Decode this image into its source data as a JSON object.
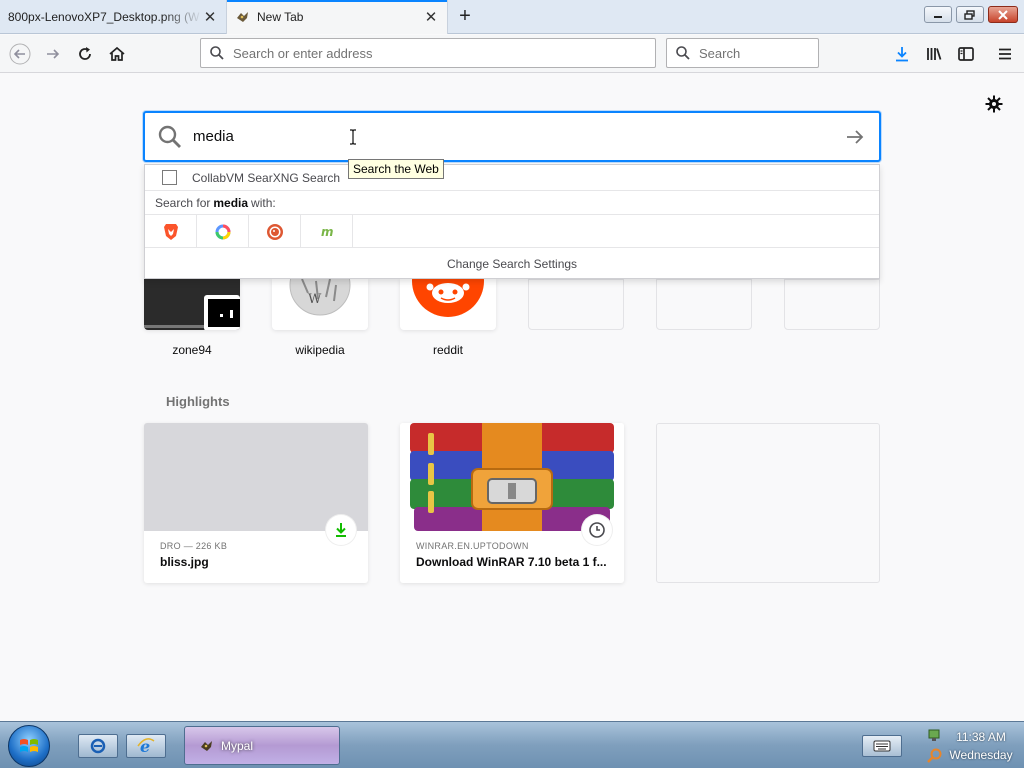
{
  "tabs": [
    {
      "title": "800px-LenovoXP7_Desktop.png (W",
      "close_icon": "close-icon"
    },
    {
      "title": "New Tab",
      "close_icon": "close-icon"
    }
  ],
  "toolbar": {
    "address_placeholder": "Search or enter address",
    "search_placeholder": "Search"
  },
  "newtab": {
    "search_value": "media",
    "tooltip": "Search the Web",
    "suggestion": "CollabVM SearXNG Search",
    "search_for_prefix": "Search for",
    "search_for_term": "media",
    "search_for_suffix": "with:",
    "engines": [
      "brave-icon",
      "qwant-icon",
      "duckduckgo-icon",
      "mojeek-icon"
    ],
    "change_settings": "Change Search Settings",
    "top_sites": [
      {
        "label": "zone94"
      },
      {
        "label": "wikipedia"
      },
      {
        "label": "reddit"
      },
      {
        "label": ""
      },
      {
        "label": ""
      },
      {
        "label": ""
      }
    ],
    "highlights_title": "Highlights",
    "highlights": [
      {
        "source": "DRO — 226 KB",
        "title": "bliss.jpg",
        "badge": "download-icon"
      },
      {
        "source": "WINRAR.EN.UPTODOWN",
        "title": "Download WinRAR 7.10 beta 1 f...",
        "badge": "clock-icon"
      }
    ]
  },
  "taskbar": {
    "task_label": "Mypal",
    "time": "11:38 AM",
    "day": "Wednesday"
  },
  "colors": {
    "accent": "#0a84ff",
    "download_green": "#12bc00"
  }
}
